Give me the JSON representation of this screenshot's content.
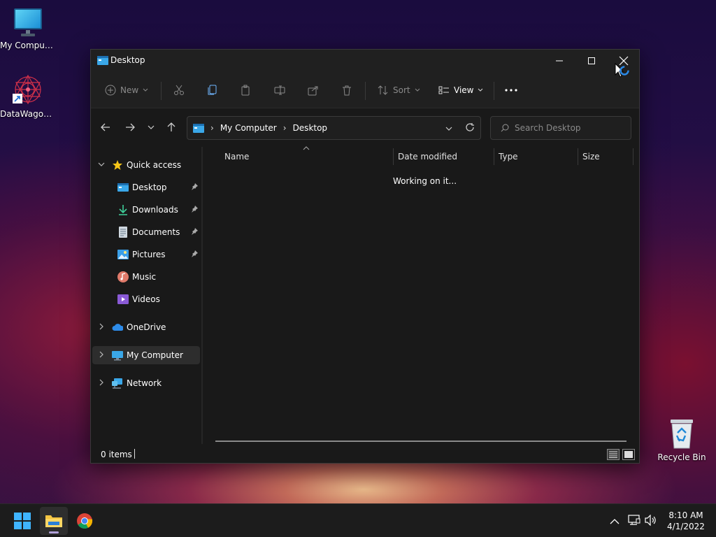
{
  "desktop": {
    "icons": [
      {
        "label": "My Computer"
      },
      {
        "label": "DataWagon..."
      },
      {
        "label": "Recycle Bin"
      }
    ]
  },
  "window": {
    "title": "Desktop",
    "toolbar": {
      "new_label": "New",
      "sort_label": "Sort",
      "view_label": "View"
    },
    "address": {
      "crumbs": [
        "My Computer",
        "Desktop"
      ]
    },
    "search": {
      "placeholder": "Search Desktop"
    },
    "sidebar": {
      "quick_access": "Quick access",
      "items": [
        {
          "label": "Desktop",
          "icon": "desktop-icon",
          "pinned": true
        },
        {
          "label": "Downloads",
          "icon": "download-icon",
          "pinned": true
        },
        {
          "label": "Documents",
          "icon": "document-icon",
          "pinned": true
        },
        {
          "label": "Pictures",
          "icon": "picture-icon",
          "pinned": true
        },
        {
          "label": "Music",
          "icon": "music-icon",
          "pinned": false
        },
        {
          "label": "Videos",
          "icon": "video-icon",
          "pinned": false
        }
      ],
      "onedrive": "OneDrive",
      "mycomputer": "My Computer",
      "network": "Network"
    },
    "columns": [
      "Name",
      "Date modified",
      "Type",
      "Size"
    ],
    "status_message": "Working on it...",
    "statusbar": {
      "items": "0 items"
    }
  },
  "taskbar": {
    "time": "8:10 AM",
    "date": "4/1/2022"
  },
  "colors": {
    "window_bg": "#191919",
    "titlebar_bg": "#202020",
    "selection": "#2d2d2d",
    "taskbar_bg": "#1c1c1c"
  }
}
